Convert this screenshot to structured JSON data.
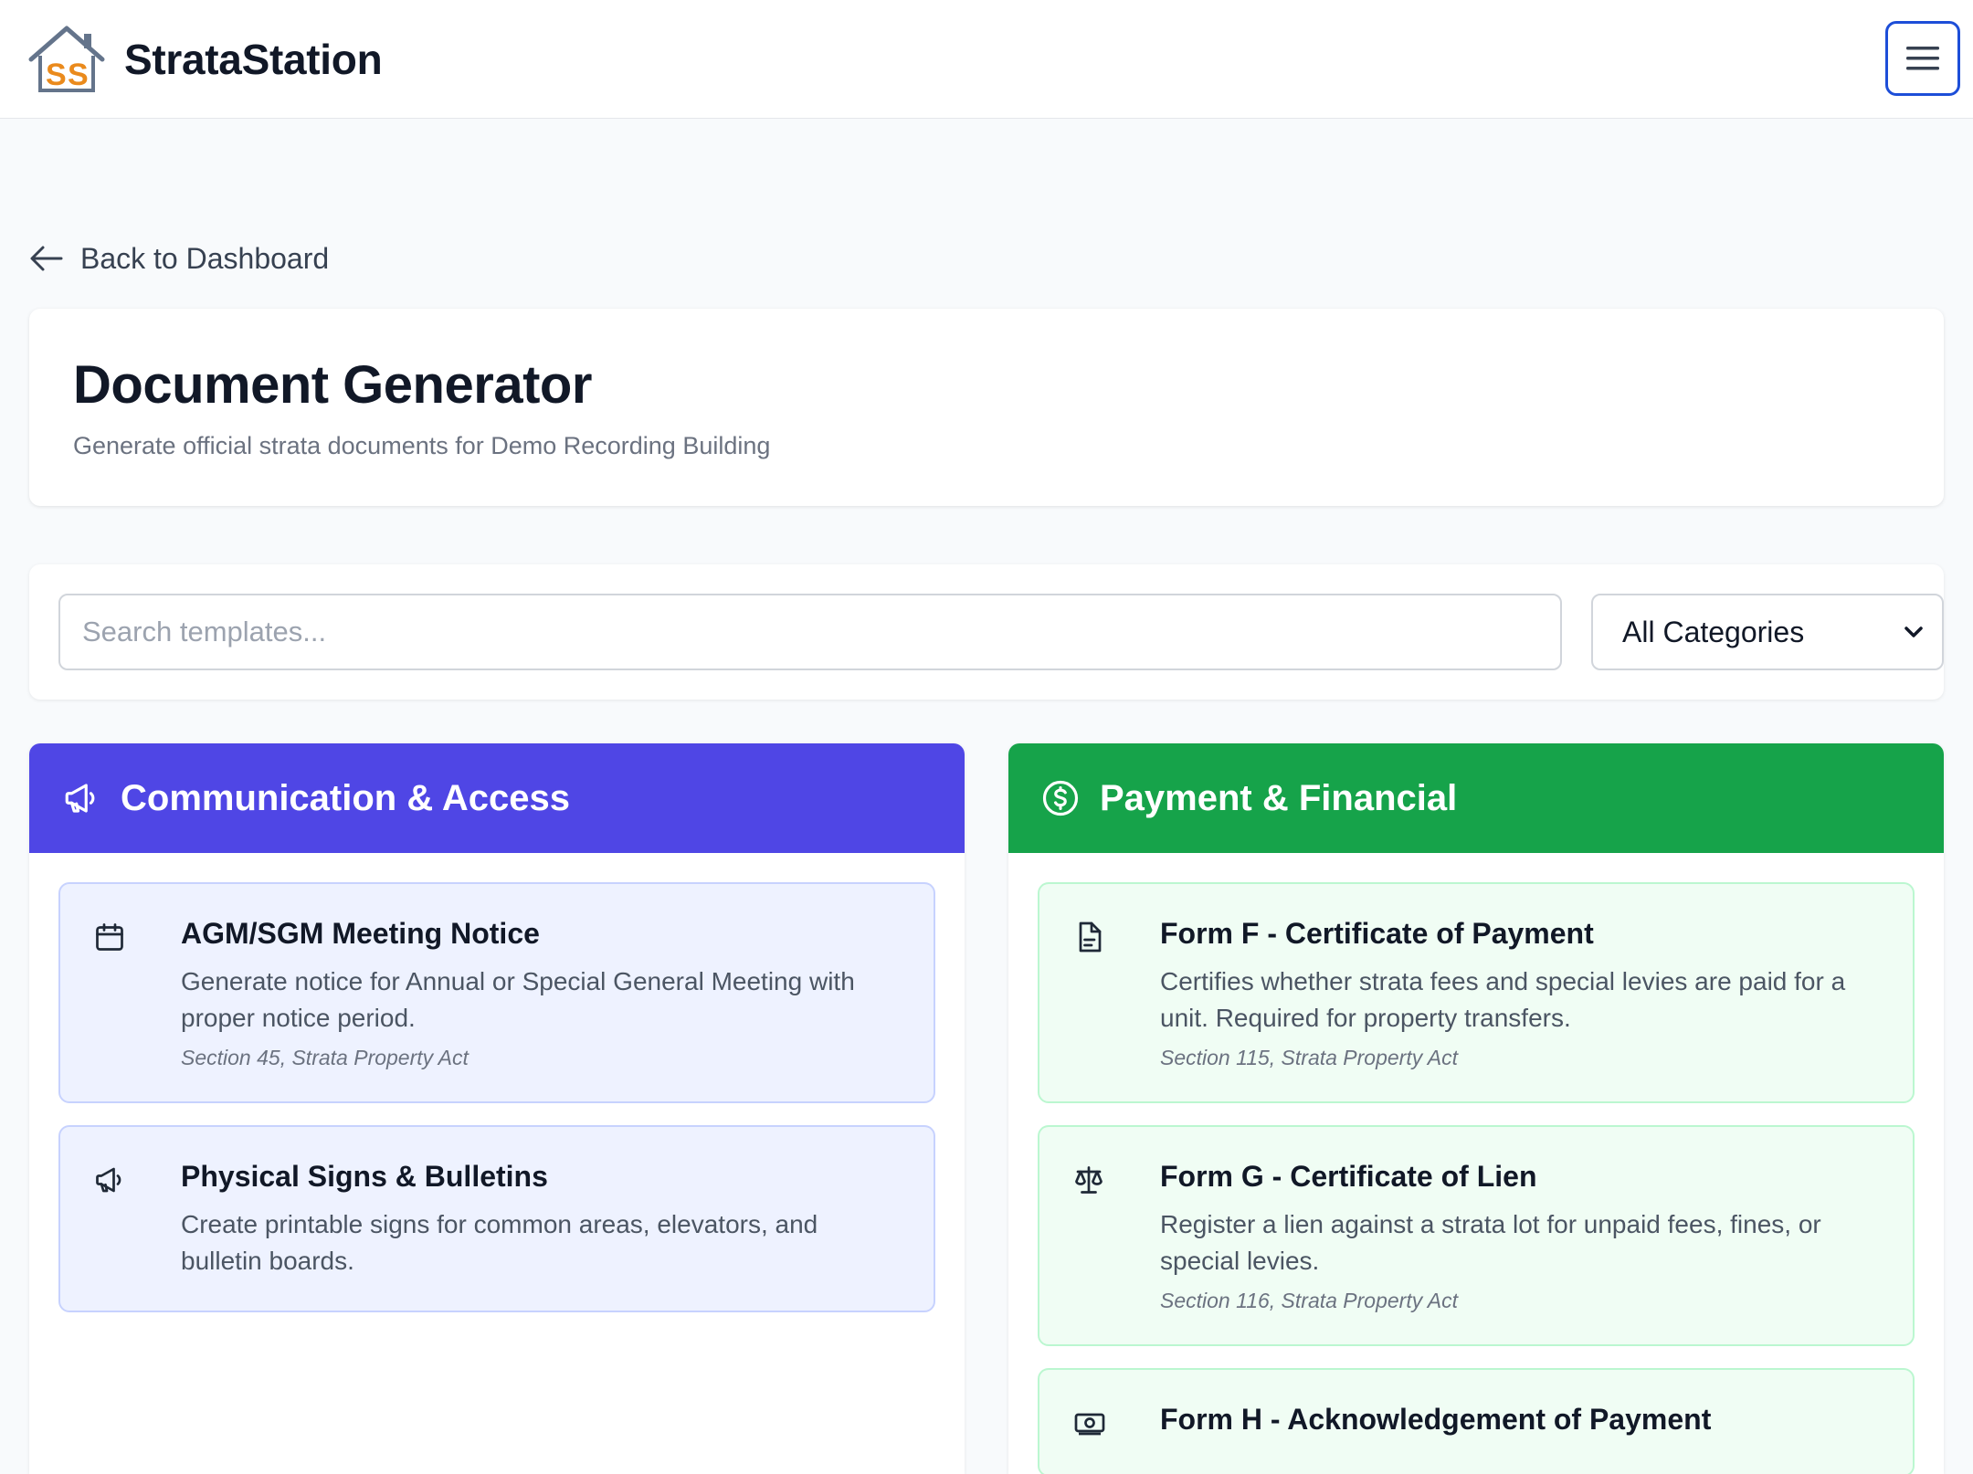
{
  "app": {
    "brand": "StrataStation",
    "menu_icon": "hamburger-menu-icon"
  },
  "nav": {
    "back_label": "Back to Dashboard"
  },
  "header": {
    "title": "Document Generator",
    "subtitle": "Generate official strata documents for Demo Recording Building"
  },
  "filters": {
    "search_placeholder": "Search templates...",
    "category_selected": "All Categories"
  },
  "colors": {
    "communication": "#4f46e5",
    "financial": "#16a34a",
    "menu_border": "#1d4ed8"
  },
  "sections": [
    {
      "title": "Communication & Access",
      "icon": "megaphone-icon",
      "templates": [
        {
          "title": "AGM/SGM Meeting Notice",
          "icon": "calendar-icon",
          "description": "Generate notice for Annual or Special General Meeting with proper notice period.",
          "reference": "Section 45, Strata Property Act"
        },
        {
          "title": "Physical Signs & Bulletins",
          "icon": "megaphone-icon",
          "description": "Create printable signs for common areas, elevators, and bulletin boards."
        }
      ]
    },
    {
      "title": "Payment & Financial",
      "icon": "dollar-circle-icon",
      "templates": [
        {
          "title": "Form F - Certificate of Payment",
          "icon": "document-icon",
          "description": "Certifies whether strata fees and special levies are paid for a unit. Required for property transfers.",
          "reference": "Section 115, Strata Property Act"
        },
        {
          "title": "Form G - Certificate of Lien",
          "icon": "scales-icon",
          "description": "Register a lien against a strata lot for unpaid fees, fines, or special levies.",
          "reference": "Section 116, Strata Property Act"
        },
        {
          "title": "Form H - Acknowledgement of Payment",
          "icon": "banknote-icon"
        }
      ]
    }
  ]
}
